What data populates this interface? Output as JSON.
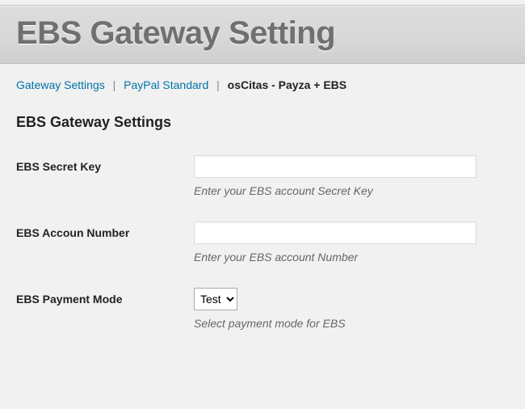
{
  "header": {
    "title": "EBS Gateway Setting"
  },
  "breadcrumb": {
    "items": [
      {
        "label": "Gateway Settings",
        "active": false
      },
      {
        "label": "PayPal Standard",
        "active": false
      },
      {
        "label": "osCitas - Payza + EBS",
        "active": true
      }
    ],
    "sep": "|"
  },
  "section_title": "EBS Gateway Settings",
  "fields": {
    "secret_key": {
      "label": "EBS Secret Key",
      "value": "",
      "help": "Enter your EBS account Secret Key"
    },
    "account_number": {
      "label": "EBS Accoun Number",
      "value": "",
      "help": "Enter your EBS account Number"
    },
    "payment_mode": {
      "label": "EBS Payment Mode",
      "selected": "Test",
      "help": "Select payment mode for EBS"
    }
  }
}
